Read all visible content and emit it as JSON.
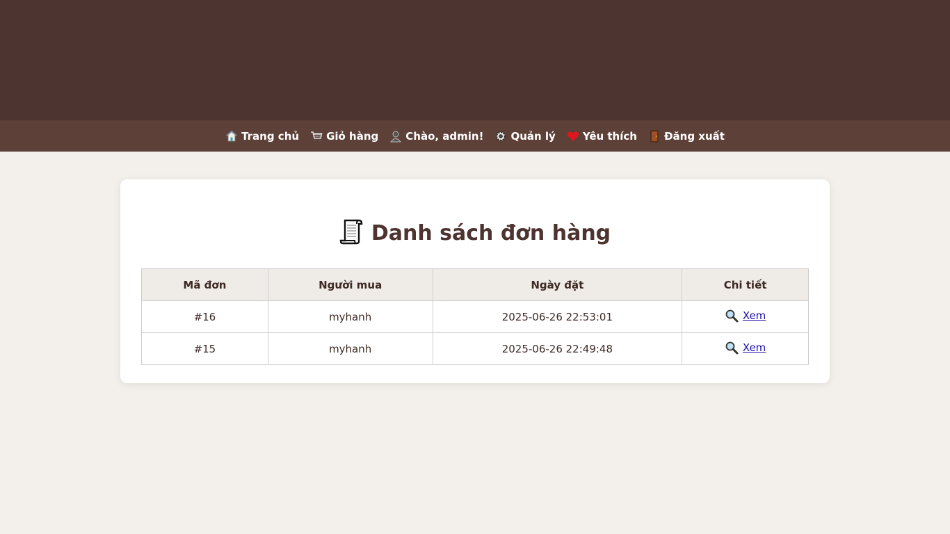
{
  "nav": {
    "items": [
      {
        "icon": "house-icon",
        "label": "Trang chủ"
      },
      {
        "icon": "cart-icon",
        "label": "Giỏ hàng"
      },
      {
        "icon": "user-icon",
        "label": "Chào, admin!"
      },
      {
        "icon": "gear-icon",
        "label": "Quản lý"
      },
      {
        "icon": "heart-icon",
        "label": "Yêu thích"
      },
      {
        "icon": "door-icon",
        "label": "Đăng xuất"
      }
    ]
  },
  "main": {
    "title": "Danh sách đơn hàng",
    "title_icon": "scroll-icon",
    "table": {
      "headers": [
        "Mã đơn",
        "Người mua",
        "Ngày đặt",
        "Chi tiết"
      ],
      "rows": [
        {
          "id": "#16",
          "buyer": "myhanh",
          "date": "2025-06-26 22:53:01",
          "action": "Xem"
        },
        {
          "id": "#15",
          "buyer": "myhanh",
          "date": "2025-06-26 22:49:48",
          "action": "Xem"
        }
      ]
    }
  },
  "colors": {
    "header_bg": "#4e3430",
    "nav_bg": "#5d4037",
    "page_bg": "#f3f0eb",
    "link": "#1a0dab"
  }
}
